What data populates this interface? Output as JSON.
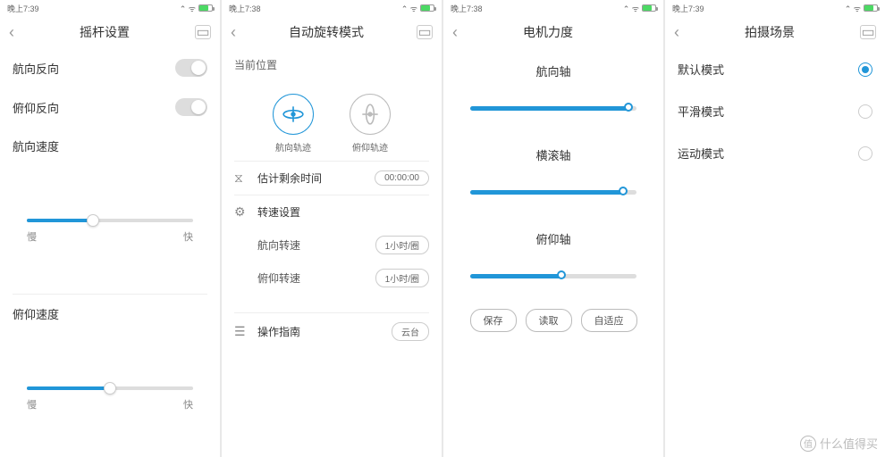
{
  "status": {
    "time": "晚上7:39",
    "time2": "晚上7:38"
  },
  "s1": {
    "title": "摇杆设置",
    "heading_reverse": "航向反向",
    "pitch_reverse": "俯仰反向",
    "heading_speed": "航向速度",
    "pitch_speed": "俯仰速度",
    "slow": "慢",
    "fast": "快"
  },
  "s2": {
    "title": "自动旋转模式",
    "current_pos": "当前位置",
    "traj_heading": "航向轨迹",
    "traj_pitch": "俯仰轨迹",
    "est_time_label": "估计剩余时间",
    "est_time_value": "00:00:00",
    "speed_settings": "转速设置",
    "heading_rpm": "航向转速",
    "pitch_rpm": "俯仰转速",
    "rpm_value": "1小时/圈",
    "guide": "操作指南",
    "guide_tag": "云台"
  },
  "s3": {
    "title": "电机力度",
    "axis_heading": "航向轴",
    "axis_roll": "横滚轴",
    "axis_pitch": "俯仰轴",
    "save": "保存",
    "load": "读取",
    "auto": "自适应"
  },
  "s4": {
    "title": "拍摄场景",
    "mode_default": "默认模式",
    "mode_smooth": "平滑模式",
    "mode_sport": "运动模式"
  },
  "watermark": "什么值得买",
  "chart_data": {
    "type": "table",
    "note": "UI sliders – approximate percentages read from pixels",
    "screen1_sliders": [
      {
        "name": "航向速度",
        "value": 40,
        "range": [
          0,
          100
        ]
      },
      {
        "name": "俯仰速度",
        "value": 50,
        "range": [
          0,
          100
        ]
      }
    ],
    "screen3_sliders": [
      {
        "name": "航向轴",
        "value": 95,
        "range": [
          0,
          100
        ]
      },
      {
        "name": "横滚轴",
        "value": 92,
        "range": [
          0,
          100
        ]
      },
      {
        "name": "俯仰轴",
        "value": 55,
        "range": [
          0,
          100
        ]
      }
    ]
  }
}
